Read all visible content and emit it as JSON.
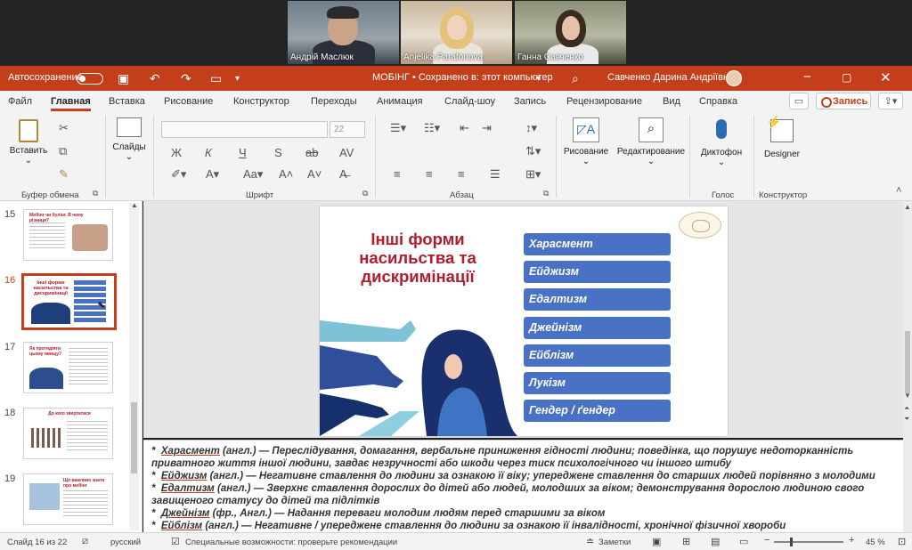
{
  "video": {
    "participants": [
      "Андрій Маслюк",
      "Anjelika Parafonova",
      "Ганна Савченко"
    ]
  },
  "titlebar": {
    "autosave_label": "Автосохранение",
    "doc_title": "МОБІНГ • Сохранено в: этот компьютер",
    "user_name": "Савченко Дарина Андріївна"
  },
  "menu": {
    "tabs": [
      "Файл",
      "Главная",
      "Вставка",
      "Рисование",
      "Конструктор",
      "Переходы",
      "Анимация",
      "Слайд-шоу",
      "Запись",
      "Рецензирование",
      "Вид",
      "Справка"
    ],
    "record_label": "Запись"
  },
  "ribbon": {
    "paste_label": "Вставить",
    "slides_label": "Слайды",
    "font_size": "22",
    "drawing_label": "Рисование",
    "editing_label": "Редактирование",
    "dictation_label": "Диктофон",
    "designer_label": "Designer",
    "groups": [
      "Буфер обмена",
      "Шрифт",
      "Абзац",
      "Голос",
      "Конструктор"
    ]
  },
  "thumbnails": [
    {
      "number": "15",
      "title": "Мобінг чи булінг. В чому різниця?"
    },
    {
      "number": "16",
      "title": "Інші форми насильства та дискримінації"
    },
    {
      "number": "17",
      "title": "Як протидіяти цьому явищу?"
    },
    {
      "number": "18",
      "title": "До кого звертатися"
    },
    {
      "number": "19",
      "title": "Що важливо знати про мобінг"
    }
  ],
  "slide": {
    "title": "Інші форми насильства та дискримінації",
    "items": [
      "Харасмент",
      "Ейджизм",
      "Едалтизм",
      "Джейнізм",
      "Ейблізм",
      "Лукізм",
      "Гендер / ґендер"
    ]
  },
  "notes": [
    {
      "term": "Харасмент",
      "rest": " (англ.) — Переслідування, домагання, вербальне приниження гідності людини; поведінка, що порушує недоторканність"
    },
    {
      "term": "",
      "rest": "приватного життя іншої людини, завдає незручності або шкоди через тиск психологічного чи іншого штибу"
    },
    {
      "term": "Ейджизм",
      "rest": " (англ.) — Негативне ставлення до людини за ознакою її віку; упереджене ставлення до старших людей порівняно з молодими"
    },
    {
      "term": "Едалтизм",
      "rest": " (англ.) — Зверхнє ставлення дорослих до дітей або людей, молодших за віком; демонстрування дорослою людиною свого"
    },
    {
      "term": "",
      "rest": "завищеного статусу до дітей та підлітків"
    },
    {
      "term": "Джейнізм",
      "rest": " (фр., Англ.) — Надання переваги молодим людям перед старшими за віком"
    },
    {
      "term": "Ейблізм",
      "rest": " (англ.) — Негативне / упереджене ставлення до людини за ознакою її інвалідності, хронічної фізичної хвороби"
    }
  ],
  "status": {
    "slide_counter": "Слайд 16 из 22",
    "language": "русский",
    "accessibility": "Специальные возможности: проверьте рекомендации",
    "notes_label": "Заметки",
    "zoom": "45 %"
  },
  "colors": {
    "accent": "#c43e1c",
    "pill": "#4a72c4",
    "slide_title": "#b21c2c"
  }
}
